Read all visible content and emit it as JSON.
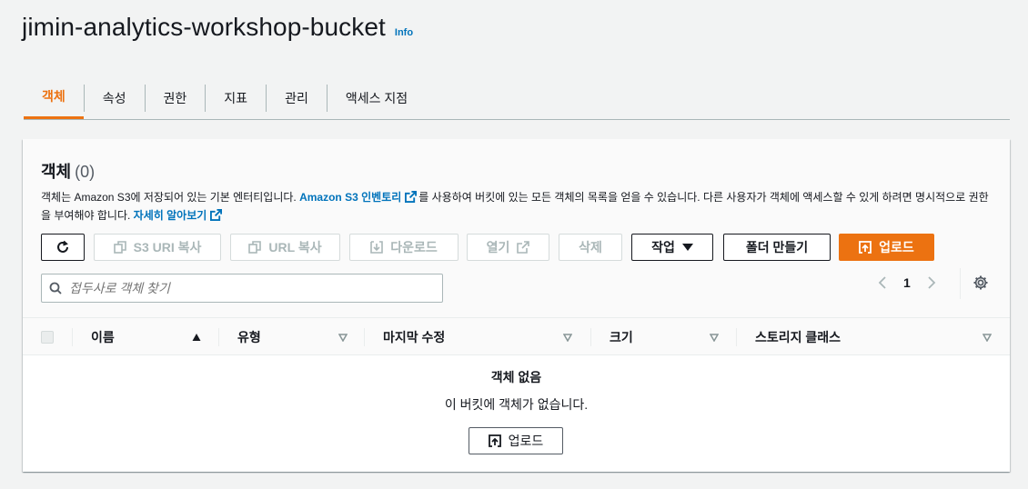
{
  "header": {
    "title": "jimin-analytics-workshop-bucket",
    "info": "Info"
  },
  "tabs": [
    {
      "label": "객체"
    },
    {
      "label": "속성"
    },
    {
      "label": "권한"
    },
    {
      "label": "지표"
    },
    {
      "label": "관리"
    },
    {
      "label": "액세스 지점"
    }
  ],
  "panel": {
    "title": "객체",
    "count": "(0)",
    "desc_1": "객체는 Amazon S3에 저장되어 있는 기본 엔터티입니다. ",
    "desc_link_1": "Amazon S3 인벤토리",
    "desc_2": "를 사용하여 버킷에 있는 모든 객체의 목록을 얻을 수 있습니다. 다른 사용자가 객체에 액세스할 수 있게 하려면 명시적으로 권한을 부여해야 합니다. ",
    "desc_link_2": "자세히 알아보기"
  },
  "toolbar": {
    "refresh": "",
    "copy_s3_uri": "S3 URI 복사",
    "copy_url": "URL 복사",
    "download": "다운로드",
    "open": "열기",
    "delete": "삭제",
    "actions": "작업",
    "create_folder": "폴더 만들기",
    "upload": "업로드"
  },
  "search": {
    "placeholder": "접두사로 객체 찾기"
  },
  "pagination": {
    "current_page": "1"
  },
  "table": {
    "columns": [
      "이름",
      "유형",
      "마지막 수정",
      "크기",
      "스토리지 클래스"
    ],
    "rows": []
  },
  "empty_state": {
    "title": "객체 없음",
    "description": "이 버킷에 객체가 없습니다.",
    "upload": "업로드"
  },
  "colors": {
    "accent": "#ec7211",
    "link": "#0073bb"
  }
}
